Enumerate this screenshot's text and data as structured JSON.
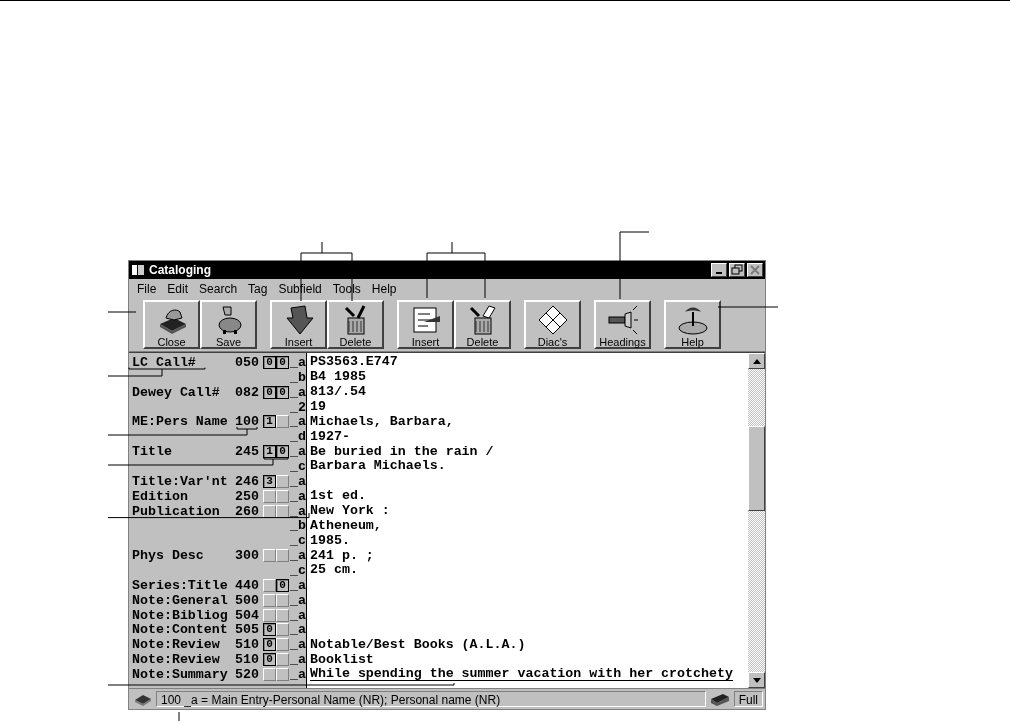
{
  "window": {
    "title": "Cataloging",
    "controls": [
      {
        "kind": "minimize",
        "disabled": false
      },
      {
        "kind": "restore",
        "disabled": false
      },
      {
        "kind": "close",
        "disabled": true
      }
    ]
  },
  "menu": [
    {
      "label": "File"
    },
    {
      "label": "Edit"
    },
    {
      "label": "Search"
    },
    {
      "label": "Tag"
    },
    {
      "label": "Subfield"
    },
    {
      "label": "Tools"
    },
    {
      "label": "Help"
    }
  ],
  "toolbar": [
    {
      "buttons": [
        {
          "label": "Close",
          "kind": "close"
        },
        {
          "label": "Save",
          "kind": "save"
        }
      ]
    },
    {
      "buttons": [
        {
          "label": "Insert",
          "kind": "insert-field"
        },
        {
          "label": "Delete",
          "kind": "delete-field"
        }
      ]
    },
    {
      "buttons": [
        {
          "label": "Insert",
          "kind": "insert-subfield"
        },
        {
          "label": "Delete",
          "kind": "delete-subfield"
        }
      ]
    },
    {
      "buttons": [
        {
          "label": "Diac's",
          "kind": "diacritics"
        }
      ]
    },
    {
      "buttons": [
        {
          "label": "Headings",
          "kind": "headings"
        }
      ]
    },
    {
      "buttons": [
        {
          "label": "Help",
          "kind": "help"
        }
      ]
    }
  ],
  "record": [
    {
      "label": "LC Call#",
      "tag": "050",
      "ind1": "0",
      "ind2": "0",
      "code": "_a",
      "value": "PS3563.E747",
      "underlined": false
    },
    {
      "code": "_b",
      "value": "B4 1985",
      "underlined": false
    },
    {
      "label": "Dewey Call#",
      "tag": "082",
      "ind1": "0",
      "ind2": "0",
      "code": "_a",
      "value": "813/.54",
      "underlined": false
    },
    {
      "code": "_2",
      "value": "19",
      "underlined": false
    },
    {
      "label": "ME:Pers Name",
      "tag": "100",
      "ind1": "1",
      "code": "_a",
      "value": "Michaels, Barbara,",
      "underlined": false
    },
    {
      "code": "_d",
      "value": "1927-",
      "underlined": false
    },
    {
      "label": "Title",
      "tag": "245",
      "ind1": "1",
      "ind2": "0",
      "code": "_a",
      "value": "Be buried in the rain /",
      "underlined": false
    },
    {
      "code": "_c",
      "value": "Barbara Michaels.",
      "underlined": false
    },
    {
      "label": "Title:Var'nt",
      "tag": "246",
      "ind1": "3",
      "code": "_a"
    },
    {
      "label": "Edition",
      "tag": "250",
      "code": "_a",
      "value": "1st ed.",
      "underlined": false
    },
    {
      "label": "Publication",
      "tag": "260",
      "code": "_a",
      "value": "New York :",
      "underlined": false
    },
    {
      "code": "_b",
      "value": "Atheneum,",
      "underlined": false
    },
    {
      "code": "_c",
      "value": "1985.",
      "underlined": false
    },
    {
      "label": "Phys Desc",
      "tag": "300",
      "code": "_a",
      "value": "241 p. ;",
      "underlined": false
    },
    {
      "code": "_c",
      "value": "25 cm.",
      "underlined": false
    },
    {
      "label": "Series:Title",
      "tag": "440",
      "ind2": "0",
      "code": "_a"
    },
    {
      "label": "Note:General",
      "tag": "500",
      "code": "_a"
    },
    {
      "label": "Note:Bibliog",
      "tag": "504",
      "code": "_a"
    },
    {
      "label": "Note:Content",
      "tag": "505",
      "ind1": "0",
      "code": "_a"
    },
    {
      "label": "Note:Review",
      "tag": "510",
      "ind1": "0",
      "code": "_a",
      "value": "Notable/Best Books (A.L.A.)",
      "underlined": false
    },
    {
      "label": "Note:Review",
      "tag": "510",
      "ind1": "0",
      "code": "_a",
      "value": "Booklist",
      "underlined": false
    },
    {
      "label": "Note:Summary",
      "tag": "520",
      "code": "_a",
      "value": "While spending the summer vacation with her crotchety",
      "underlined": true
    }
  ],
  "status_bar": {
    "message": "100 _a = Main Entry-Personal Name (NR); Personal name (NR)",
    "mode": "Full"
  }
}
